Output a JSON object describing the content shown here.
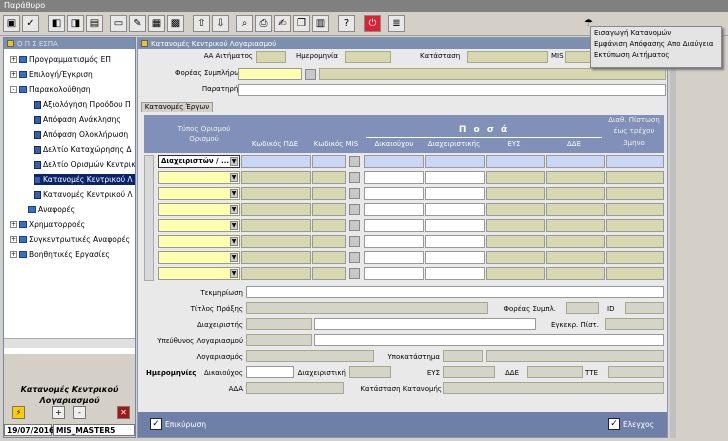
{
  "window": {
    "title": "Παράθυρο"
  },
  "toolbar": {
    "buttons": [
      "save-icon",
      "check-icon",
      "record-prev-icon",
      "record-next-icon",
      "new-document-icon",
      "edit-icon",
      "grid-icon",
      "grid2-icon",
      "arrow-up-icon",
      "arrow-down-icon",
      "search-icon",
      "print-icon",
      "edit-pen-icon",
      "copy-icon",
      "paste-icon",
      "help-icon",
      "power-icon",
      "notes-icon"
    ]
  },
  "context_menu": {
    "items": [
      "Εισαγωγή Κατανομών",
      "Εμφάνιση Απόφασης Απο Διαύγεια",
      "Εκτύπωση Αιτήματος"
    ]
  },
  "sidebar": {
    "header": "Ο Π Σ ΕΣΠΑ",
    "tree": [
      {
        "label": "Προγραμματισμός ΕΠ",
        "level": 0,
        "expand": "+"
      },
      {
        "label": "Επιλογή/Έγκριση",
        "level": 0,
        "expand": "+"
      },
      {
        "label": "Παρακολούθηση",
        "level": 0,
        "expand": "-"
      },
      {
        "label": "Αξιολόγηση Προόδου Π",
        "level": 1
      },
      {
        "label": "Απόφαση Ανάκλησης",
        "level": 1
      },
      {
        "label": "Απόφαση Ολοκλήρωση",
        "level": 1
      },
      {
        "label": "Δελτίο Καταχώρησης Δ",
        "level": 1
      },
      {
        "label": "Δελτίο Ορισμών Κεντρικ",
        "level": 1
      },
      {
        "label": "Κατανομές Κεντρικού Λ",
        "level": 1,
        "selected": true
      },
      {
        "label": "Κατανομές Κεντρικού Λ",
        "level": 1
      },
      {
        "label": "Αναφορές",
        "level": 1,
        "folder": true
      },
      {
        "label": "Χρηματορροές",
        "level": 0,
        "expand": "+"
      },
      {
        "label": "Συγκεντρωτικές Αναφορές",
        "level": 0,
        "expand": "+"
      },
      {
        "label": "Βοηθητικές Εργασίες",
        "level": 0,
        "expand": "+"
      }
    ],
    "panel_title_1": "Κατανομές Κεντρικού",
    "panel_title_2": "Λογαριασμού",
    "plus": "+",
    "minus": "-",
    "date": "19/07/2016",
    "user": "MIS_MASTER5"
  },
  "form": {
    "title": "Κατανομές Κεντρικού Λογαριασμού",
    "labels": {
      "aa": "ΑΑ Αιτήματος",
      "date": "Ημερομηνία",
      "status": "Κατάσταση",
      "mis": "MIS",
      "foreas": "Φορέας Συμπλήρωσης",
      "notes": "Παρατηρήσεις"
    },
    "tab": "Κατανομές Έργων",
    "grid": {
      "headers": {
        "type": "Τύπος Ορισμού",
        "pde": "Κωδικός ΠΔΕ",
        "mis": "Κωδικός MIS",
        "posa": "Π ο σ ά",
        "dik": "Δικαιούχου",
        "diax": "Διαχειριστικής",
        "eys": "ΕΥΣ",
        "dde": "ΔΔΕ",
        "avail_1": "Διαθ. Πίστωση",
        "avail_2": "έως τρέχον",
        "avail_3": "3μηνο"
      },
      "first_value": "Διαχειριστών / ..."
    },
    "details": {
      "tekm": "Τεκμηρίωση",
      "praxi": "Τίτλος Πράξης",
      "foreas_symp": "Φορέας Συμπλ.",
      "id": "ID",
      "diax": "Διαχειριστής",
      "egkr": "Εγκεκρ. Πίστ.",
      "ypeyth": "Υπεύθυνος Λογαριασμού",
      "logar": "Λογαριασμός",
      "ypok": "Υποκατάστημα",
      "dates": "Ημερομηνίες",
      "dik": "Δικαιούχος",
      "diaxeir": "Διαχειριστική",
      "eys": "ΕΥΣ",
      "dde": "ΔΔΕ",
      "tte": "ΤΤΕ",
      "ada": "ΑΔΑ",
      "katast": "Κατάσταση Κατανομής"
    },
    "bottom": {
      "confirm": "Επικύρωση",
      "check": "Ελεγχος"
    }
  }
}
